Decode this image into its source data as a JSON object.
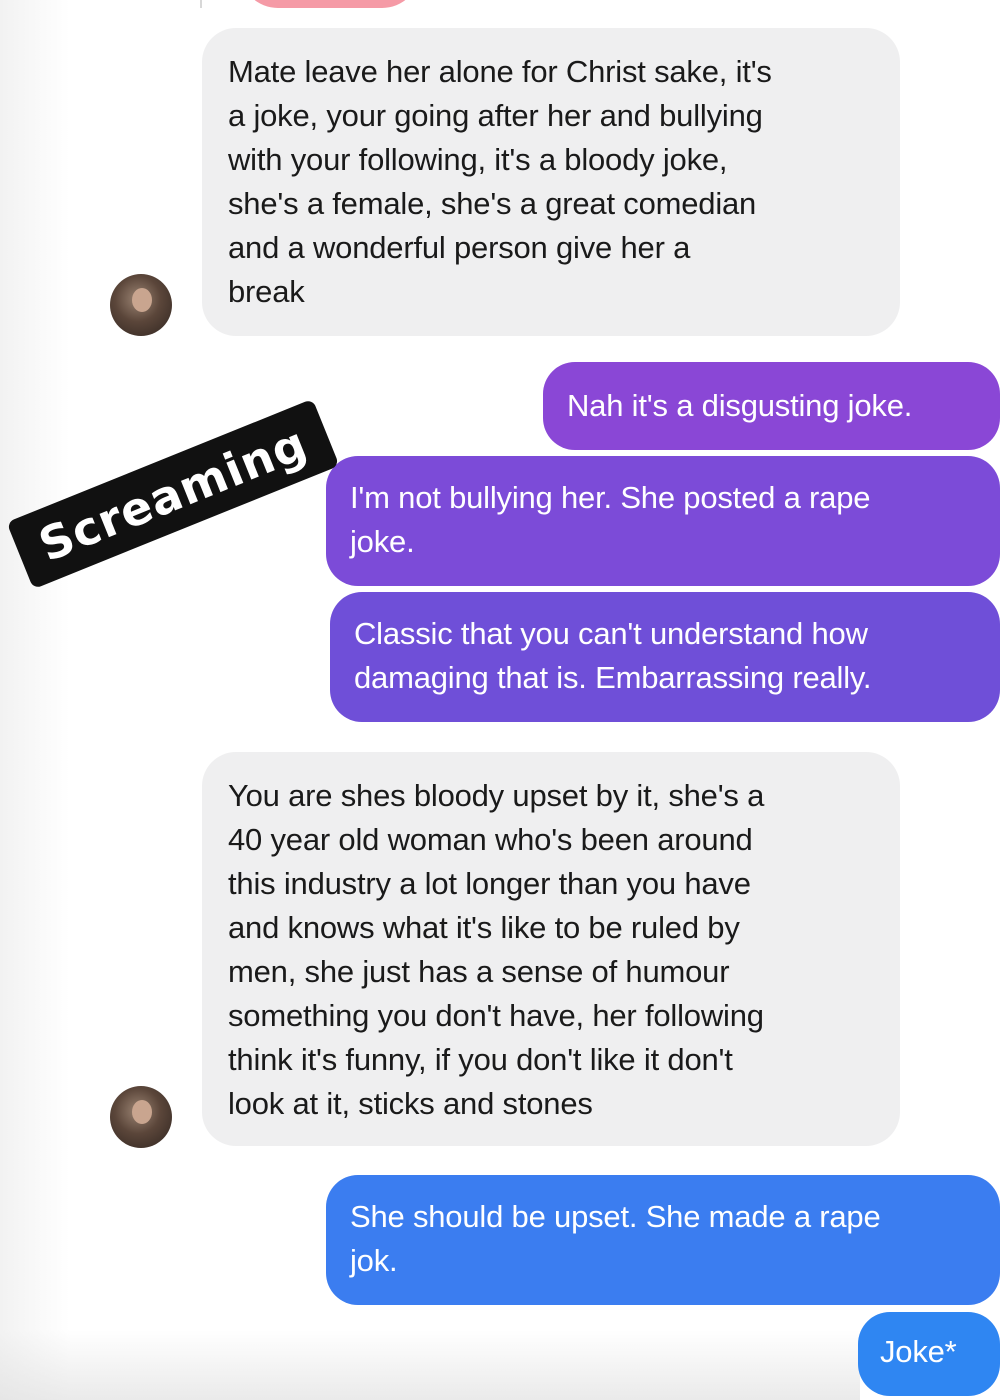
{
  "sticker": {
    "label": "Screaming"
  },
  "messages": [
    {
      "direction": "incoming",
      "text": "Mate leave her alone for Christ sake, it's\na joke, your going after her and bullying\nwith your following, it's a bloody joke,\nshe's a female, she's a great comedian\nand a wonderful person give her a\nbreak",
      "color": "#efeff0"
    },
    {
      "direction": "outgoing",
      "text": "Nah it's a disgusting joke.",
      "color": "#8a47d6"
    },
    {
      "direction": "outgoing",
      "text": "I'm not bullying her. She posted a rape\njoke.",
      "color": "#7c4bd8"
    },
    {
      "direction": "outgoing",
      "text": "Classic that you can't understand how\ndamaging that is. Embarrassing really.",
      "color": "#6f4fd8"
    },
    {
      "direction": "incoming",
      "text": "You are shes bloody upset by it, she's a\n40 year old woman who's been around\nthis industry a lot longer than you have\nand knows what it's like to be ruled by\nmen, she just has a sense of humour\nsomething you don't have, her following\nthink it's funny, if you don't like it don't\nlook at it, sticks and stones",
      "color": "#efeff0"
    },
    {
      "direction": "outgoing",
      "text": "She should be upset. She made a rape\njok.",
      "color": "#3b7df0"
    },
    {
      "direction": "outgoing",
      "text": "Joke*",
      "color": "#2f86f2"
    }
  ]
}
